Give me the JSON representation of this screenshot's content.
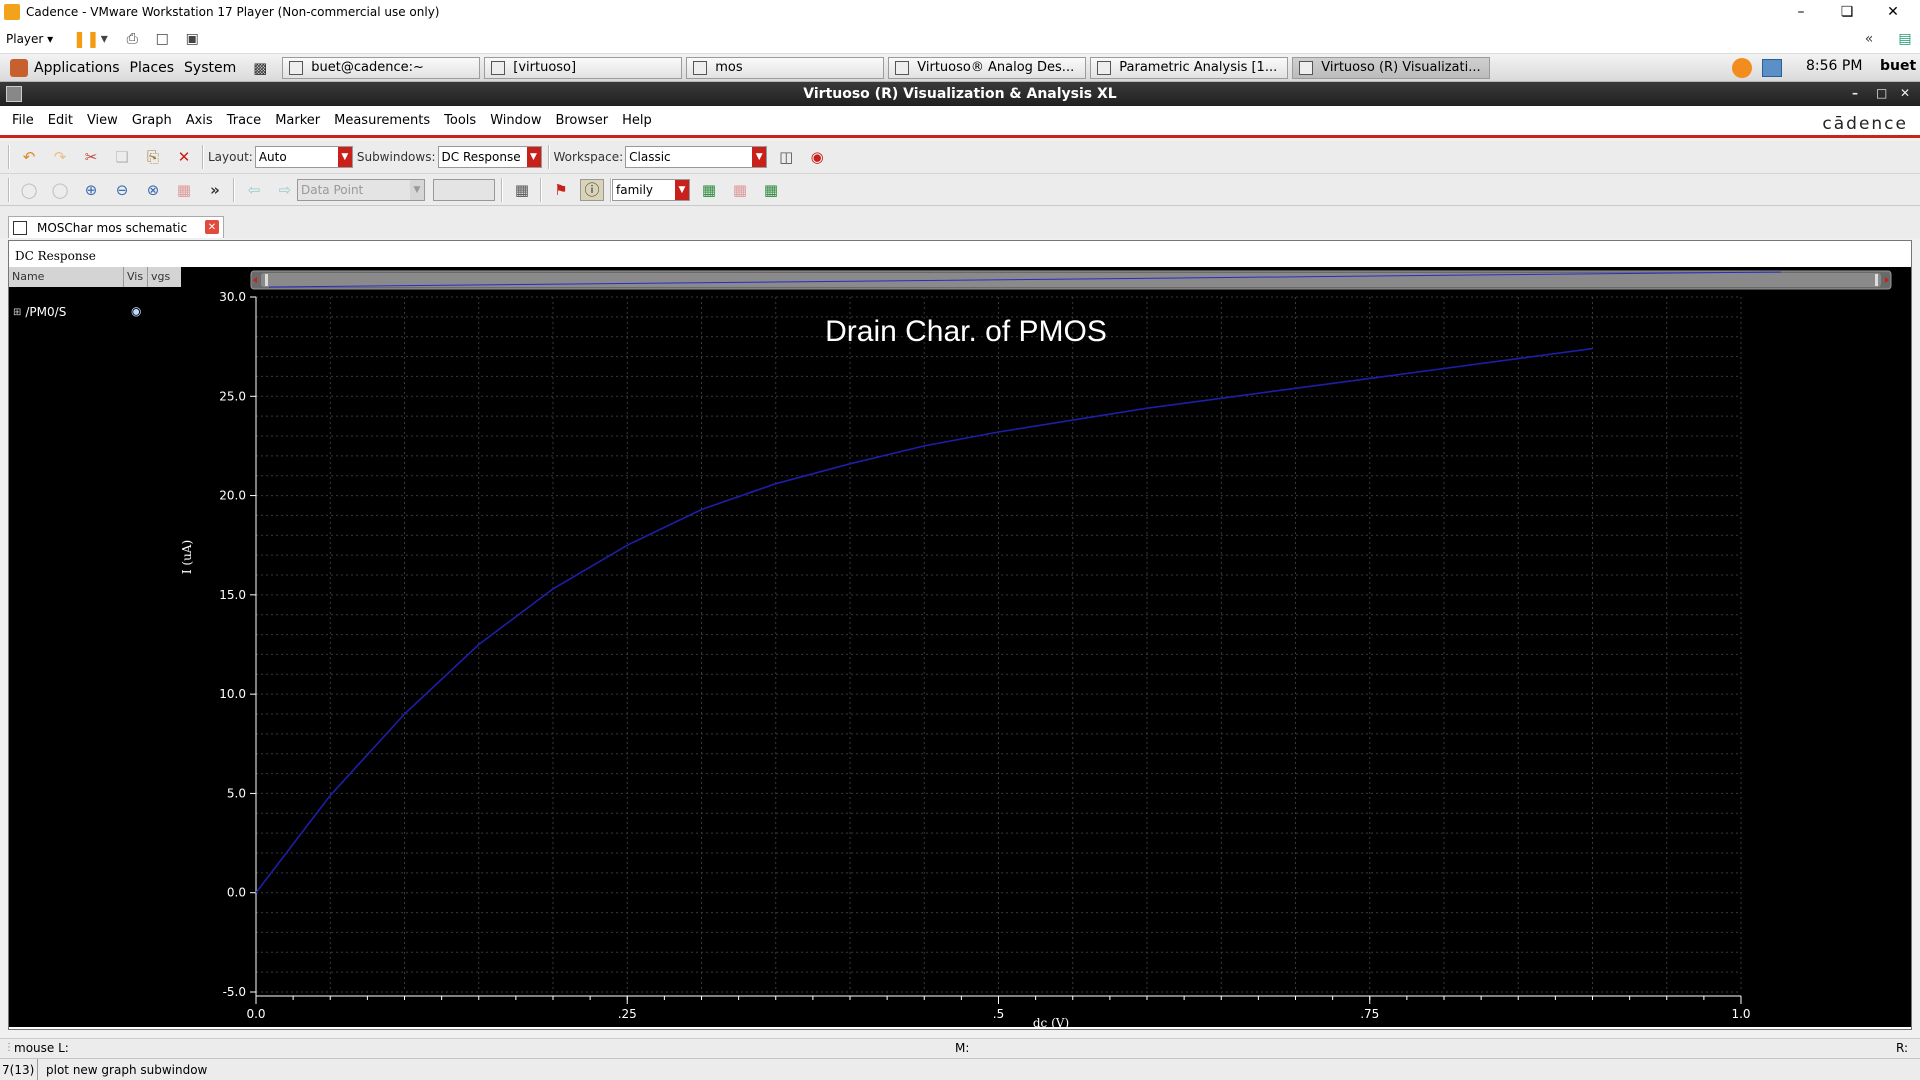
{
  "vmware": {
    "title": "Cadence - VMware Workstation 17 Player (Non-commercial use only)",
    "player_label": "Player"
  },
  "panel": {
    "menus": [
      "Applications",
      "Places",
      "System"
    ],
    "tasks": [
      "buet@cadence:~",
      "[virtuoso]",
      "mos",
      "Virtuoso® Analog Des...",
      "Parametric Analysis [1...",
      "Virtuoso (R) Visualizati..."
    ],
    "clock": "8:56 PM",
    "user": "buet"
  },
  "window": {
    "title": "Virtuoso (R) Visualization & Analysis XL",
    "logo": "cādence"
  },
  "menubar": [
    "File",
    "Edit",
    "View",
    "Graph",
    "Axis",
    "Trace",
    "Marker",
    "Measurements",
    "Tools",
    "Window",
    "Browser",
    "Help"
  ],
  "toolbar": {
    "layout_label": "Layout:",
    "layout_value": "Auto",
    "subwindows_label": "Subwindows:",
    "subwindows_value": "DC Response",
    "workspace_label": "Workspace:",
    "workspace_value": "Classic",
    "data_point_value": "Data Point",
    "family_value": "family"
  },
  "tab": {
    "label": "MOSChar mos schematic"
  },
  "subwindow": {
    "title": "DC Response",
    "columns": [
      "Name",
      "Vis",
      "vgs"
    ],
    "trace_name": "/PM0/S"
  },
  "chart_data": {
    "type": "line",
    "title": "Drain Char. of PMOS",
    "xlabel": "dc (V)",
    "ylabel": "I (uA)",
    "xlim": [
      0.0,
      1.0
    ],
    "ylim": [
      -5.0,
      30.0
    ],
    "x_tick_labels": [
      "0.0",
      ".25",
      ".5",
      ".75",
      "1.0"
    ],
    "y_tick_labels": [
      "-5.0",
      "0.0",
      "5.0",
      "10.0",
      "15.0",
      "20.0",
      "25.0",
      "30.0"
    ],
    "grid": true,
    "series": [
      {
        "color": "#1e1ea8",
        "x": [
          0.0,
          0.05,
          0.1,
          0.15,
          0.2,
          0.25,
          0.3,
          0.35,
          0.4,
          0.45,
          0.5,
          0.55,
          0.6,
          0.65,
          0.7,
          0.75,
          0.8,
          0.85,
          0.9
        ],
        "y": [
          0.0,
          4.9,
          9.0,
          12.5,
          15.3,
          17.5,
          19.3,
          20.6,
          21.6,
          22.5,
          23.2,
          23.8,
          24.4,
          24.9,
          25.4,
          25.9,
          26.4,
          26.9,
          27.4
        ]
      }
    ]
  },
  "status": {
    "mouse_left": "mouse L:",
    "mouse_mid": "M:",
    "mouse_right": "R:",
    "count": "7(13)",
    "message": "plot new graph subwindow"
  }
}
